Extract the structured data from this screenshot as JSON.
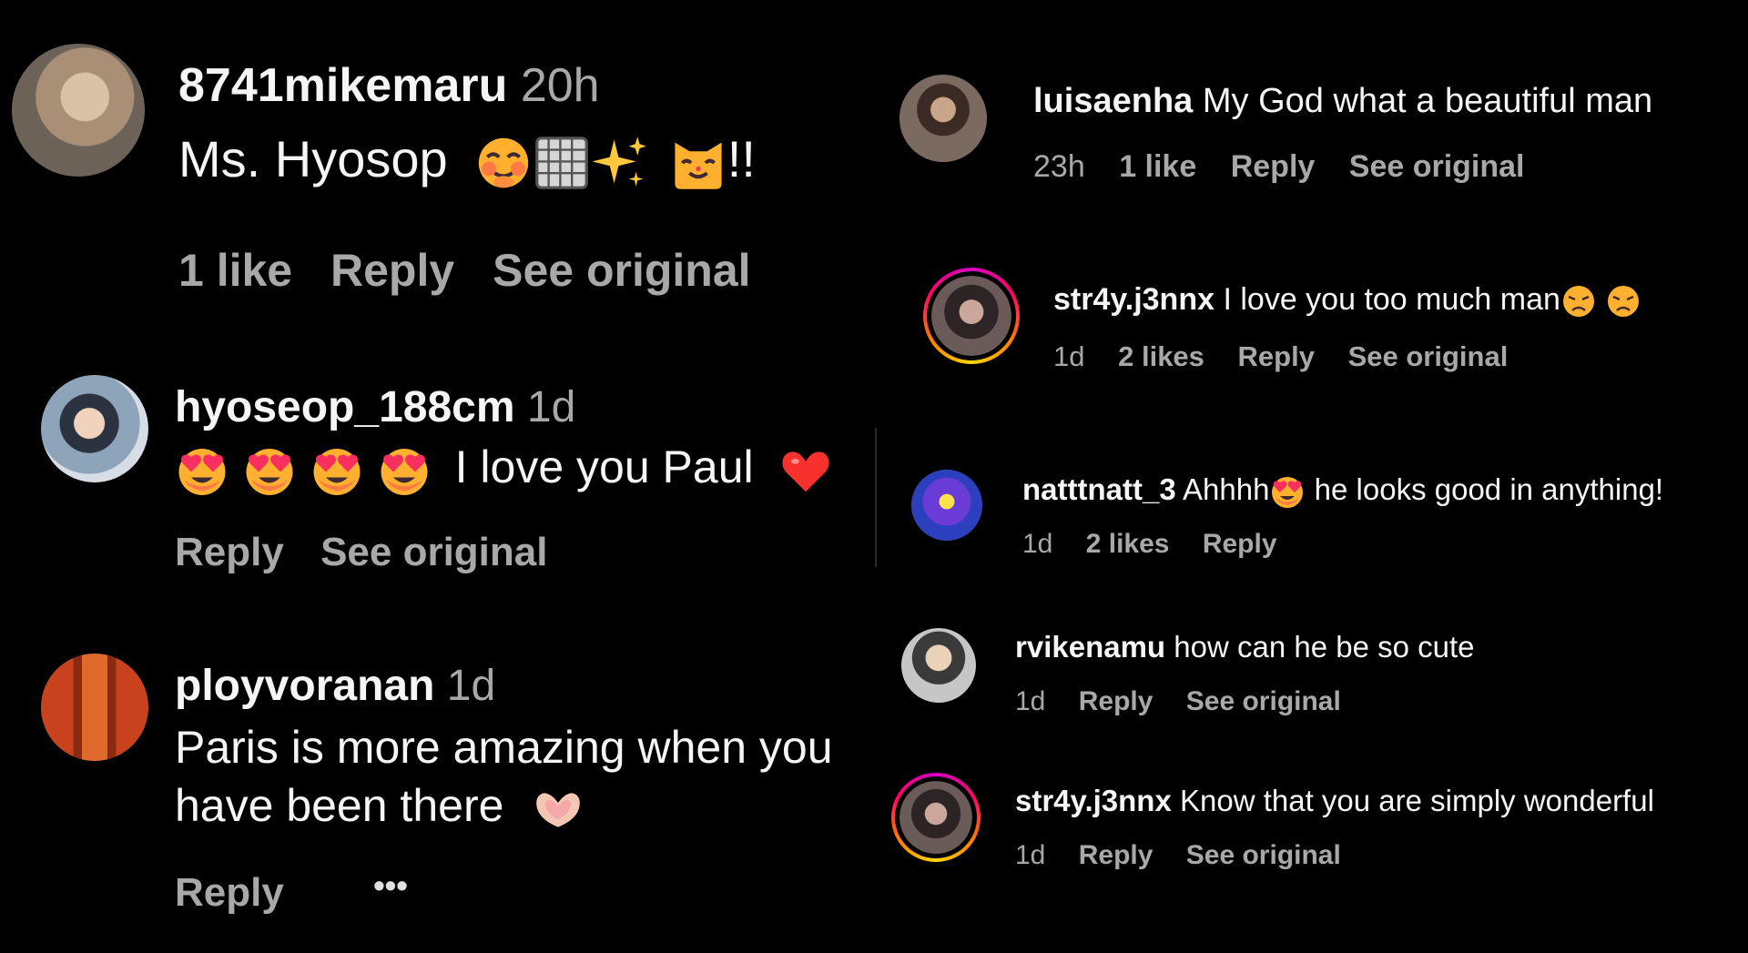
{
  "left_comments": [
    {
      "username": "8741mikemaru",
      "time": "20h",
      "text": "Ms. Hyosop",
      "emojis": [
        "blushing-face",
        "grid-symbol",
        "sparkles",
        "cat-face"
      ],
      "text_suffix": "!!",
      "likes": "1 like",
      "reply": "Reply",
      "see_original": "See original"
    },
    {
      "username": "hyoseop_188cm",
      "time": "1d",
      "emojis_prefix": [
        "heart-eyes",
        "heart-eyes",
        "heart-eyes",
        "heart-eyes"
      ],
      "text": "I love you Paul",
      "emojis_suffix": [
        "red-heart"
      ],
      "reply": "Reply",
      "see_original": "See original"
    },
    {
      "username": "ployvoranan",
      "time": "1d",
      "text_line1": "Paris is more amazing when you",
      "text_line2": "have been there",
      "emojis_suffix": [
        "heart-hands"
      ],
      "reply": "Reply",
      "more": "•••"
    }
  ],
  "right_comments": [
    {
      "username": "luisaenha",
      "text": "My God what a beautiful man",
      "time": "23h",
      "likes": "1 like",
      "reply": "Reply",
      "see_original": "See original"
    },
    {
      "username": "str4y.j3nnx",
      "text": "I love you too much man",
      "emojis_suffix": [
        "weary-face",
        "weary-face"
      ],
      "time": "1d",
      "likes": "2 likes",
      "reply": "Reply",
      "see_original": "See original"
    },
    {
      "username": "natttnatt_3",
      "text_before": "Ahhhh",
      "emojis_mid": [
        "heart-eyes"
      ],
      "text_after": "he looks good in anything!",
      "time": "1d",
      "likes": "2 likes",
      "reply": "Reply"
    },
    {
      "username": "rvikenamu",
      "text": "how can he be so cute",
      "time": "1d",
      "reply": "Reply",
      "see_original": "See original"
    },
    {
      "username": "str4y.j3nnx",
      "text": "Know that you are simply wonderful",
      "time": "1d",
      "reply": "Reply",
      "see_original": "See original"
    }
  ],
  "colors": {
    "background": "#000000",
    "primary_text": "#f5f5f5",
    "secondary_text": "#a8a8a8",
    "story_ring": [
      "#d300c5",
      "#ff0069",
      "#ff7a00",
      "#ffd600"
    ]
  }
}
